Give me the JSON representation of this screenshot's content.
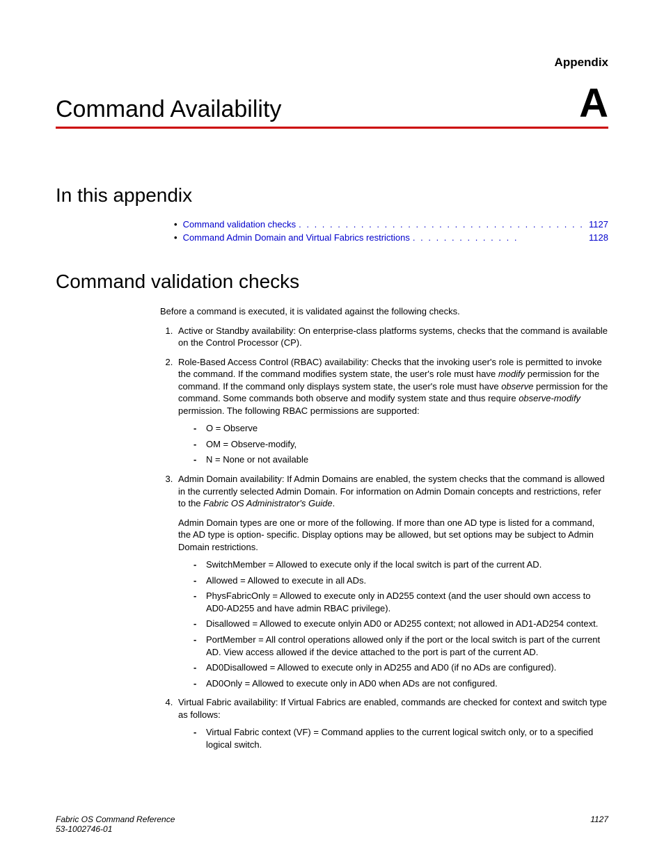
{
  "header": {
    "appendix_label": "Appendix",
    "title": "Command Availability",
    "letter": "A"
  },
  "sections": {
    "toc_heading": "In this appendix",
    "toc": [
      {
        "label": "Command validation checks",
        "page": "1127"
      },
      {
        "label": "Command Admin Domain and Virtual Fabrics restrictions",
        "page": "1128"
      }
    ],
    "validation_heading": "Command validation checks",
    "intro": "Before a command is executed, it is validated against the following checks.",
    "items": {
      "i1": "Active or Standby availability: On enterprise-class platforms systems, checks that the command is available on the Control Processor (CP).",
      "i2_pre": "Role-Based Access Control (RBAC) availability: Checks that the invoking user's role is permitted to invoke the command. If the command modifies system state, the user's role must have ",
      "i2_mod": "modify",
      "i2_mid": " permission for the command. If the command only displays system state, the user's role must have ",
      "i2_obs": "observe",
      "i2_mid2": " permission for the command. Some commands both observe and modify system state and thus require ",
      "i2_om": "observe-modify",
      "i2_post": " permission. The following RBAC permissions are supported:",
      "i2_sub": [
        "O = Observe",
        "OM = Observe-modify,",
        "N = None or not available"
      ],
      "i3_pre": "Admin Domain availability: If Admin Domains are enabled, the system checks that the command is allowed in the currently selected Admin Domain. For information on Admin Domain concepts and restrictions, refer to the ",
      "i3_em": "Fabric OS Administrator's Guide",
      "i3_post": ".",
      "i3_p2": "Admin Domain types are one or more of the following. If more than one AD type is listed for a command, the AD type is option- specific. Display options may be allowed, but set options may be subject to Admin Domain restrictions.",
      "i3_sub": [
        "SwitchMember = Allowed to execute only if the local switch is part of the current AD.",
        "Allowed = Allowed to execute in all ADs.",
        "PhysFabricOnly = Allowed to execute only in AD255 context (and the user should own access to AD0-AD255 and have admin RBAC privilege).",
        "Disallowed = Allowed to execute onlyin AD0 or AD255 context; not allowed in AD1-AD254 context.",
        "PortMember = All control operations allowed only if the port or the local switch is part of the current AD. View access allowed if the device attached to the port is part of the current AD.",
        "AD0Disallowed = Allowed to execute only in AD255 and AD0 (if no ADs are configured).",
        "AD0Only = Allowed to execute only in AD0 when ADs are not configured."
      ],
      "i4": "Virtual Fabric availability: If Virtual Fabrics are enabled, commands are checked for context and switch type as follows:",
      "i4_sub": [
        "Virtual Fabric context (VF) = Command applies to the current logical switch only, or to a specified logical switch."
      ]
    }
  },
  "footer": {
    "left1": "Fabric OS Command Reference",
    "left2": "53-1002746-01",
    "right": "1127"
  }
}
